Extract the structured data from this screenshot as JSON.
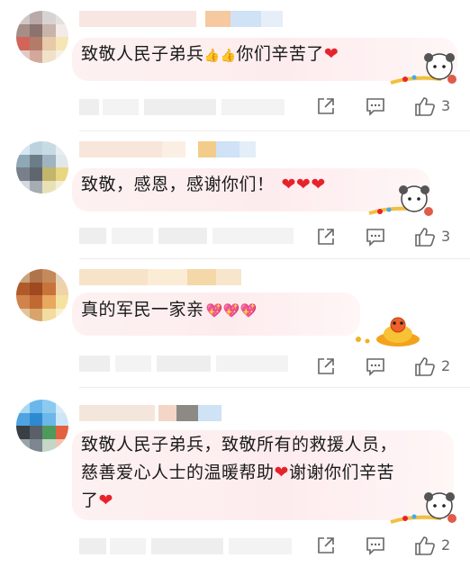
{
  "comments": [
    {
      "text_main": "致敬人民子弟兵",
      "text_emoji": "👍👍",
      "text_tail": "你们辛苦了",
      "text_heart": "❤",
      "like_count": "3"
    },
    {
      "text_main": "致敬，感恩，感谢你们！",
      "text_hearts": "❤❤❤",
      "like_count": "3"
    },
    {
      "text_main": "真的军民一家亲",
      "text_emoji": "💖💖💖",
      "like_count": "2"
    },
    {
      "line1": "致敬人民子弟兵，致敬所有的救援人员，",
      "line2_main": "慈善爱心人士的温暖帮助",
      "line2_heart": "❤",
      "line2_tail": "谢谢你们辛苦",
      "line3_main": "了",
      "line3_heart": "❤",
      "like_count": "2"
    }
  ],
  "icons": {
    "share": "share-icon",
    "comment": "comment-icon",
    "like": "thumbs-up-icon"
  },
  "colors": {
    "heart": "#e8222b",
    "bubble": "#fdeef0",
    "icon": "#666666"
  }
}
